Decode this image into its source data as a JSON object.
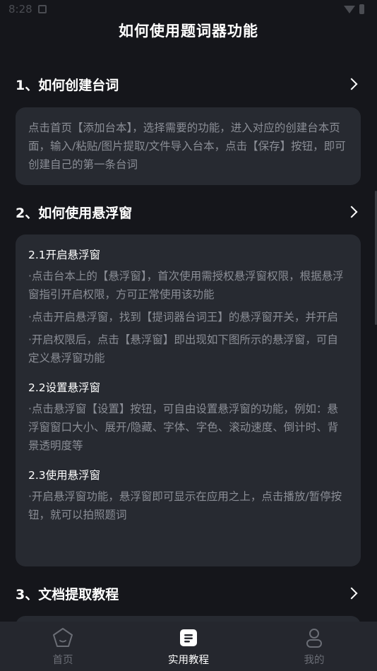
{
  "status": {
    "time": "8:28"
  },
  "header": {
    "title": "如何使用题词器功能"
  },
  "sections": [
    {
      "title": "1、如何创建台词",
      "body": "点击首页【添加台本】，选择需要的功能，进入对应的创建台本页面，输入/粘贴/图片提取/文件导入台本，点击【保存】按钮，即可创建自己的第一条台词"
    },
    {
      "title": "2、如何使用悬浮窗",
      "subsections": [
        {
          "title": "2.1开启悬浮窗",
          "items": [
            "·点击台本上的【悬浮窗】，首次使用需授权悬浮窗权限，根据悬浮窗指引开启权限，方可正常使用该功能",
            "·点击开启悬浮窗，找到【提词器台词王】的悬浮窗开关，并开启",
            "·开启权限后，点击【悬浮窗】即出现如下图所示的悬浮窗，可自定义悬浮窗功能"
          ]
        },
        {
          "title": "2.2设置悬浮窗",
          "items": [
            "·点击悬浮窗【设置】按钮，可自由设置悬浮窗的功能，例如：悬浮窗窗口大小、展开/隐藏、字体、字色、滚动速度、倒计时、背景透明度等"
          ]
        },
        {
          "title": "2.3使用悬浮窗",
          "items": [
            "·开启悬浮窗功能，悬浮窗即可显示在应用之上，点击播放/暂停按钮，就可以拍照题词"
          ]
        }
      ]
    },
    {
      "title": "3、文档提取教程"
    }
  ],
  "tabbar": {
    "items": [
      {
        "label": "首页",
        "icon": "home-pentagon-icon",
        "active": false
      },
      {
        "label": "实用教程",
        "icon": "document-icon",
        "active": true
      },
      {
        "label": "我的",
        "icon": "person-icon",
        "active": false
      }
    ]
  },
  "colors": {
    "background": "#15161b",
    "card": "#272a31",
    "body_text": "#8b8e96",
    "tabbar": "#25272e",
    "inactive_tab": "#6b6e76"
  }
}
